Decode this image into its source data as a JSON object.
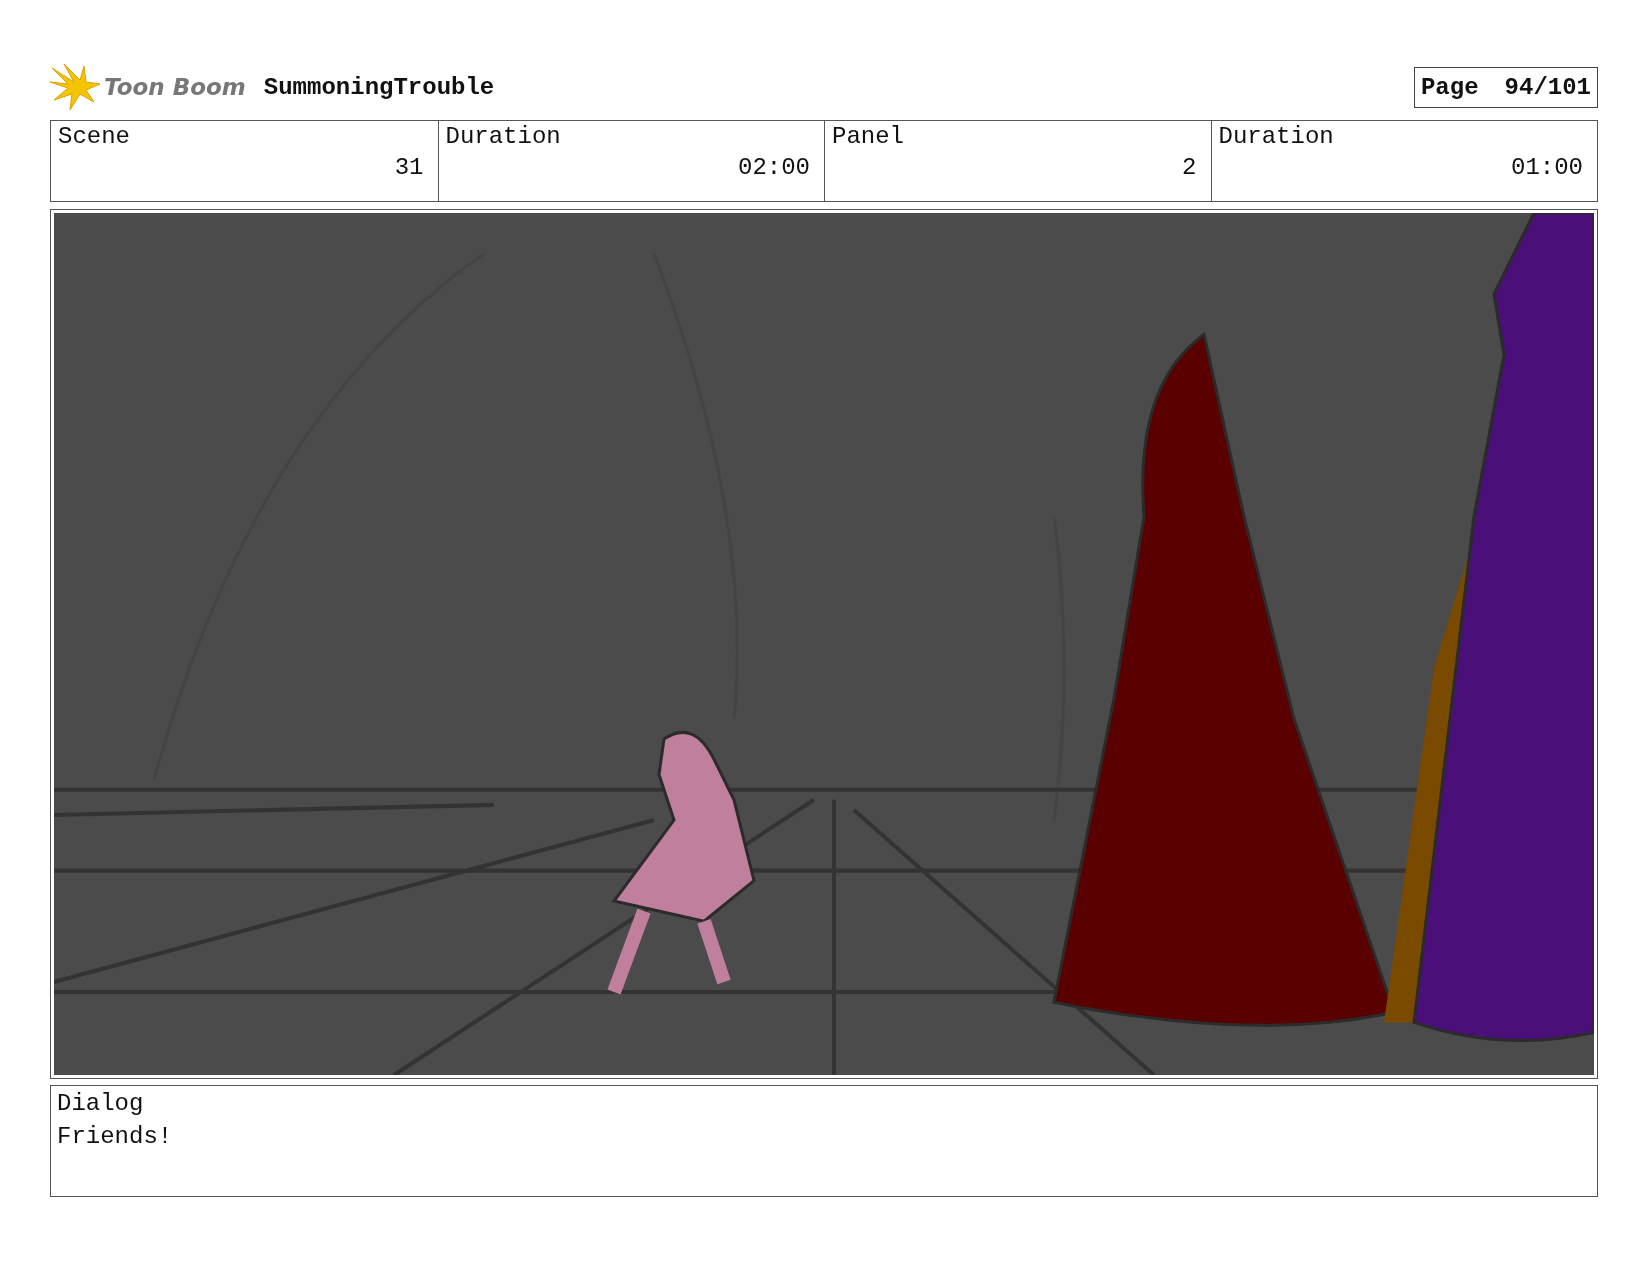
{
  "header": {
    "logo_text": "Toon Boom",
    "project_title": "SummoningTrouble",
    "page_label": "Page",
    "page_number": "94/101"
  },
  "info_table": [
    {
      "label": "Scene",
      "value": "31"
    },
    {
      "label": "Duration",
      "value": "02:00"
    },
    {
      "label": "Panel",
      "value": "2"
    },
    {
      "label": "Duration",
      "value": "01:00"
    }
  ],
  "dialog": {
    "label": "Dialog",
    "text": "Friends!"
  }
}
